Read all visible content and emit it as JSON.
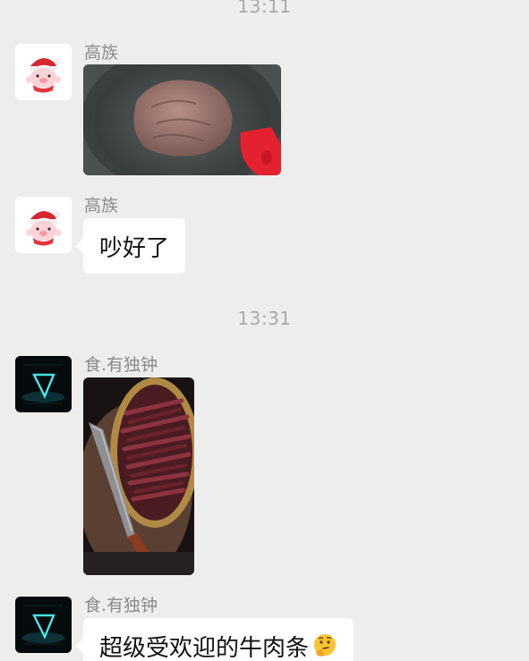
{
  "timestamps": [
    "13:11",
    "13:31"
  ],
  "messages": [
    {
      "sender": "高族",
      "type": "image",
      "image_desc": "frying-pan-with-chocolate-colored-dough"
    },
    {
      "sender": "高族",
      "type": "text",
      "text": "吵好了"
    },
    {
      "sender": "食.有独钟",
      "type": "image",
      "image_desc": "beef-strips-in-basket-with-knife"
    },
    {
      "sender": "食.有独钟",
      "type": "text",
      "text": "超级受欢迎的牛肉条",
      "emoji": "thinking-face-icon"
    }
  ],
  "colors": {
    "background": "#ededed",
    "bubble": "#ffffff",
    "timestamp": "#a9a9a9",
    "sender_name": "#8a8a8a"
  }
}
